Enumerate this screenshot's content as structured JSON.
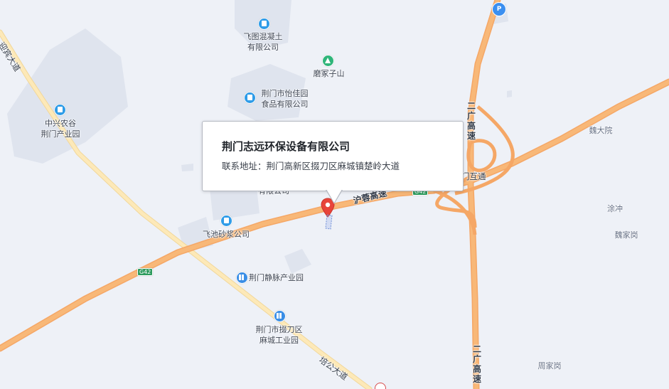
{
  "popup": {
    "title": "荆门志远环保设备有限公司",
    "address": "联系地址：荆门高新区掇刀区麻城镇楚岭大道"
  },
  "pois": {
    "feitu": [
      "飞图混凝土",
      "有限公司"
    ],
    "mojiazishan": "磨冢子山",
    "yijiayuan": [
      "荆门市怡佳园",
      "食品有限公司"
    ],
    "zhongxing": [
      "中兴农谷",
      "荆门产业园"
    ],
    "hidden_company": "有限公司",
    "feichi": "飞池砂浆公司",
    "jingmai": "荆门静脉产业园",
    "madeng": [
      "荆门市掇刀区",
      "麻城工业园"
    ]
  },
  "places": {
    "weidayuan": "魏大院",
    "tuchong": "涂冲",
    "weijiagang": "魏家岗",
    "zhoujiagang": "周家岗"
  },
  "roads": {
    "hurong": "沪蓉高速",
    "interchange": "门互通",
    "erguang_top": [
      "二",
      "广",
      "高",
      "速"
    ],
    "erguang_bottom": [
      "二",
      "广",
      "高",
      "速"
    ],
    "yingbin": "迎宾大道",
    "peigong": "培公大道",
    "shield_g42_left": "G42",
    "shield_g42_right": "G42"
  },
  "icons": {
    "service_area": "service-area-icon",
    "company": "company-icon",
    "mountain": "mountain-icon",
    "marker": "location-marker-icon"
  },
  "colors": {
    "background": "#eef1f7",
    "highway": "#f7ae6c",
    "arterial": "#fde3a7",
    "block": "#dde3ee",
    "marker": "#e8443a"
  }
}
